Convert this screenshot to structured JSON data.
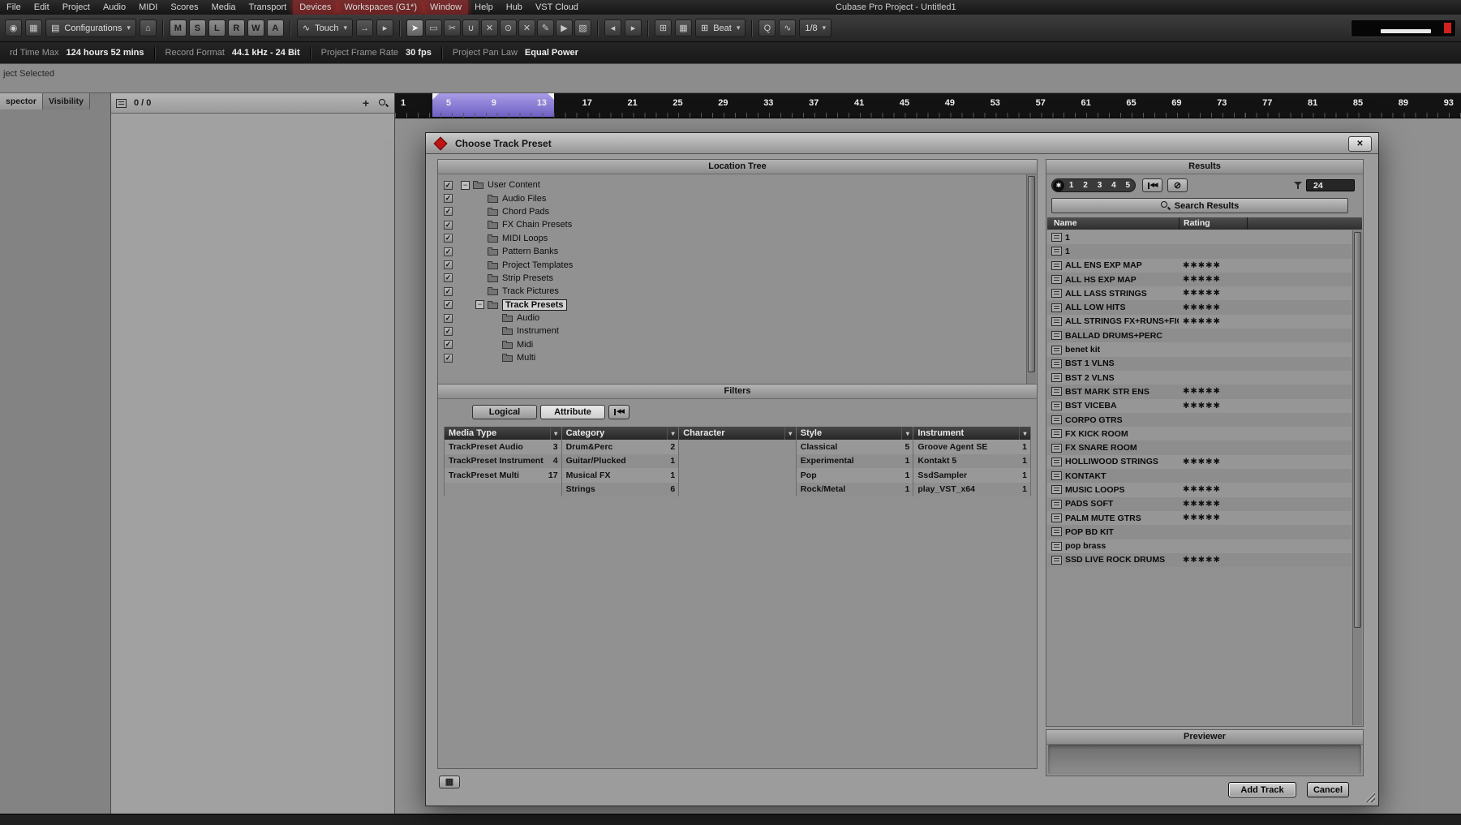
{
  "colors": {
    "accent_purple": "#8b7dd8",
    "menu_highlight": "#b43434",
    "panel_gray": "#919191",
    "dark_header": "#333333"
  },
  "icons": {
    "close": "✕",
    "check": "✓",
    "minus": "−",
    "plus": "+",
    "dropdown": "▾",
    "star": "✱",
    "home": "⌂",
    "reset": "◀◀",
    "activate": "◉",
    "setup_grid": "▦",
    "list": "▤",
    "snap": "⊞",
    "waveform": "∿",
    "arrow_right": "→",
    "nudge_left": "◂",
    "nudge_right": "▸",
    "grid_view": "▦",
    "circle_slash": "⊘"
  },
  "menu_bar": {
    "title": "Cubase Pro Project - Untitled1",
    "items": [
      {
        "label": "File"
      },
      {
        "label": "Edit"
      },
      {
        "label": "Project"
      },
      {
        "label": "Audio"
      },
      {
        "label": "MIDI"
      },
      {
        "label": "Scores"
      },
      {
        "label": "Media"
      },
      {
        "label": "Transport"
      },
      {
        "label": "Devices",
        "highlight": true
      },
      {
        "label": "Workspaces (G1*)",
        "highlight": true
      },
      {
        "label": "Window",
        "highlight": true
      },
      {
        "label": "Help"
      },
      {
        "label": "Hub"
      },
      {
        "label": "VST Cloud"
      }
    ]
  },
  "toolbar": {
    "configurations_label": "Configurations",
    "automation_mode": "Touch",
    "grid_mode": "Beat",
    "quantize_label": "Q",
    "quantize_value": "1/8",
    "state_buttons": [
      "M",
      "S",
      "L",
      "R",
      "W",
      "A"
    ],
    "tools": [
      {
        "name": "object-selection-tool",
        "glyph": "➤",
        "active": true
      },
      {
        "name": "range-selection-tool",
        "glyph": "▭"
      },
      {
        "name": "split-tool",
        "glyph": "✂"
      },
      {
        "name": "glue-tool",
        "glyph": "∪"
      },
      {
        "name": "erase-tool",
        "glyph": "✕"
      },
      {
        "name": "zoom-tool",
        "glyph": "⊙"
      },
      {
        "name": "mute-tool",
        "glyph": "✕"
      },
      {
        "name": "draw-tool",
        "glyph": "✎"
      },
      {
        "name": "play-tool",
        "glyph": "▶"
      },
      {
        "name": "color-tool",
        "glyph": "▧"
      }
    ]
  },
  "status_bar": {
    "groups": [
      {
        "label": "rd Time Max",
        "value": "124 hours 52 mins"
      },
      {
        "label": "Record Format",
        "value": "44.1 kHz - 24 Bit"
      },
      {
        "label": "Project Frame Rate",
        "value": "30 fps"
      },
      {
        "label": "Project Pan Law",
        "value": "Equal Power"
      }
    ]
  },
  "info_line": {
    "text": "ject Selected"
  },
  "left_panel": {
    "tabs": [
      {
        "label": "spector",
        "active": true
      },
      {
        "label": "Visibility"
      }
    ],
    "counter": "0 / 0"
  },
  "ruler": {
    "numbers": [
      "1",
      "5",
      "9",
      "13",
      "17",
      "21",
      "25",
      "29",
      "33",
      "37",
      "41",
      "45",
      "49",
      "53",
      "57",
      "61",
      "65",
      "69",
      "73",
      "77",
      "81",
      "85",
      "89",
      "93"
    ],
    "cycle_start_bar": "5",
    "cycle_end_bar": "13"
  },
  "dialog": {
    "title": "Choose Track Preset",
    "location_tree": {
      "header": "Location Tree",
      "items": [
        {
          "label": "User Content",
          "level": 0,
          "expander": true,
          "checked": true
        },
        {
          "label": "Audio Files",
          "level": 1,
          "checked": true
        },
        {
          "label": "Chord Pads",
          "level": 1,
          "checked": true
        },
        {
          "label": "FX Chain Presets",
          "level": 1,
          "checked": true
        },
        {
          "label": "MIDI Loops",
          "level": 1,
          "checked": true
        },
        {
          "label": "Pattern Banks",
          "level": 1,
          "checked": true
        },
        {
          "label": "Project Templates",
          "level": 1,
          "checked": true
        },
        {
          "label": "Strip Presets",
          "level": 1,
          "checked": true
        },
        {
          "label": "Track Pictures",
          "level": 1,
          "checked": true
        },
        {
          "label": "Track Presets",
          "level": 1,
          "expander": true,
          "checked": true,
          "selected": true
        },
        {
          "label": "Audio",
          "level": 2,
          "checked": true
        },
        {
          "label": "Instrument",
          "level": 2,
          "checked": true
        },
        {
          "label": "Midi",
          "level": 2,
          "checked": true
        },
        {
          "label": "Multi",
          "level": 2,
          "checked": true
        }
      ]
    },
    "filters": {
      "header": "Filters",
      "logical_label": "Logical",
      "attribute_label": "Attribute",
      "columns": [
        {
          "header": "Media Type",
          "rows": [
            {
              "name": "TrackPreset Audio",
              "count": "3"
            },
            {
              "name": "TrackPreset Instrument",
              "count": "4"
            },
            {
              "name": "TrackPreset Multi",
              "count": "17"
            }
          ]
        },
        {
          "header": "Category",
          "rows": [
            {
              "name": "Drum&Perc",
              "count": "2"
            },
            {
              "name": "Guitar/Plucked",
              "count": "1"
            },
            {
              "name": "Musical FX",
              "count": "1"
            },
            {
              "name": "Strings",
              "count": "6"
            }
          ]
        },
        {
          "header": "Character",
          "rows": []
        },
        {
          "header": "Style",
          "rows": [
            {
              "name": "Classical",
              "count": "5"
            },
            {
              "name": "Experimental",
              "count": "1"
            },
            {
              "name": "Pop",
              "count": "1"
            },
            {
              "name": "Rock/Metal",
              "count": "1"
            }
          ]
        },
        {
          "header": "Instrument",
          "rows": [
            {
              "name": "Groove Agent SE",
              "count": "1"
            },
            {
              "name": "Kontakt 5",
              "count": "1"
            },
            {
              "name": "SsdSampler",
              "count": "1"
            },
            {
              "name": "play_VST_x64",
              "count": "1"
            }
          ]
        }
      ]
    },
    "results": {
      "header": "Results",
      "rating_numbers": [
        "1",
        "2",
        "3",
        "4",
        "5"
      ],
      "count": "24",
      "search_label": "Search Results",
      "columns": {
        "name": "Name",
        "rating": "Rating"
      },
      "rows": [
        {
          "name": "1",
          "rating": 0
        },
        {
          "name": "1",
          "rating": 0
        },
        {
          "name": "ALL  ENS EXP MAP",
          "rating": 5
        },
        {
          "name": "ALL HS EXP MAP",
          "rating": 5
        },
        {
          "name": "ALL LASS STRINGS",
          "rating": 5
        },
        {
          "name": "ALL LOW  HITS",
          "rating": 5
        },
        {
          "name": "ALL STRINGS FX+RUNS+FIGURES",
          "rating": 5
        },
        {
          "name": "BALLAD DRUMS+PERC",
          "rating": 0
        },
        {
          "name": "benet kit",
          "rating": 0
        },
        {
          "name": "BST 1 VLNS",
          "rating": 0
        },
        {
          "name": "BST 2 VLNS",
          "rating": 0
        },
        {
          "name": "BST MARK STR ENS",
          "rating": 5
        },
        {
          "name": "BST VICEBA",
          "rating": 5
        },
        {
          "name": "CORPO GTRS",
          "rating": 0
        },
        {
          "name": "FX KICK ROOM",
          "rating": 0
        },
        {
          "name": "FX SNARE ROOM",
          "rating": 0
        },
        {
          "name": "HOLLIWOOD STRINGS",
          "rating": 5
        },
        {
          "name": "KONTAKT",
          "rating": 0
        },
        {
          "name": "MUSIC LOOPS",
          "rating": 5
        },
        {
          "name": "PADS SOFT",
          "rating": 5
        },
        {
          "name": "PALM MUTE GTRS",
          "rating": 5
        },
        {
          "name": "POP BD KIT",
          "rating": 0
        },
        {
          "name": "pop brass",
          "rating": 0
        },
        {
          "name": "SSD LIVE ROCK DRUMS",
          "rating": 5
        }
      ]
    },
    "previewer": {
      "header": "Previewer"
    },
    "buttons": {
      "add_track": "Add Track",
      "cancel": "Cancel"
    }
  }
}
